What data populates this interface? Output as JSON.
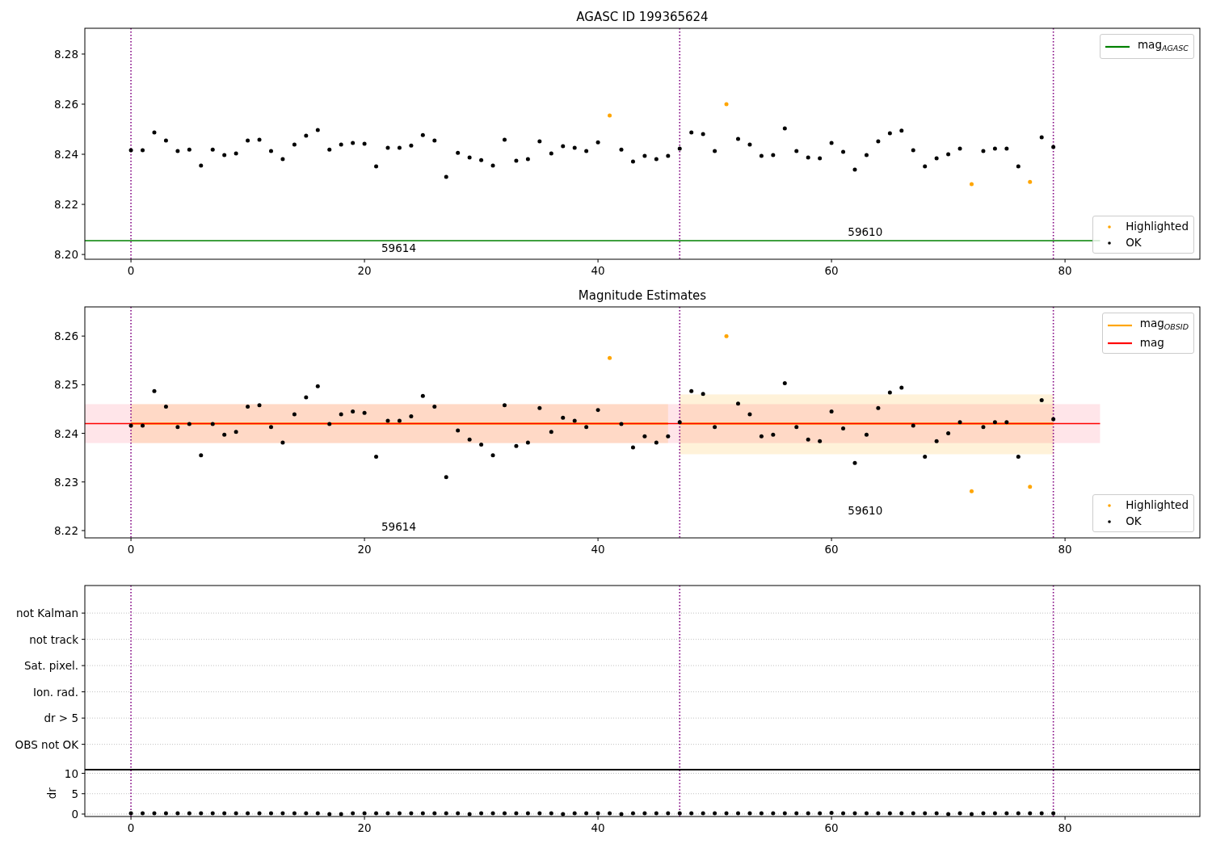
{
  "figure": {
    "panels": [
      {
        "kind": "magnitude",
        "chart_data": {
          "type": "scatter",
          "title": "AGASC ID 199365624",
          "xlim": [
            -3.95,
            91.55
          ],
          "ylim": [
            8.1981,
            8.2903
          ],
          "xticks": [
            0,
            20,
            40,
            60,
            80
          ],
          "yticks": [
            {
              "value": 8.2,
              "label": "8.20"
            },
            {
              "value": 8.22,
              "label": "8.22"
            },
            {
              "value": 8.24,
              "label": "8.24"
            },
            {
              "value": 8.26,
              "label": "8.26"
            },
            {
              "value": 8.28,
              "label": "8.28"
            }
          ],
          "x": [
            0,
            1,
            2,
            3,
            4,
            5,
            6,
            7,
            8,
            9,
            10,
            11,
            12,
            13,
            14,
            15,
            16,
            17,
            18,
            19,
            20,
            21,
            22,
            23,
            24,
            25,
            26,
            27,
            28,
            29,
            30,
            31,
            32,
            33,
            34,
            35,
            36,
            37,
            38,
            39,
            40,
            41,
            42,
            43,
            44,
            45,
            46,
            47,
            48,
            49,
            50,
            51,
            52,
            53,
            54,
            55,
            56,
            57,
            58,
            59,
            60,
            61,
            62,
            63,
            64,
            65,
            66,
            67,
            68,
            69,
            70,
            71,
            72,
            73,
            74,
            75,
            76,
            77,
            78,
            79
          ],
          "series": [
            {
              "name": "Highlighted",
              "color": "#ffa500",
              "values": [
                null,
                null,
                null,
                null,
                null,
                null,
                null,
                null,
                null,
                null,
                null,
                null,
                null,
                null,
                null,
                null,
                null,
                null,
                null,
                null,
                null,
                null,
                null,
                null,
                null,
                null,
                null,
                null,
                null,
                null,
                null,
                null,
                null,
                null,
                null,
                null,
                null,
                null,
                null,
                null,
                null,
                8.2555,
                null,
                null,
                null,
                null,
                null,
                null,
                null,
                null,
                null,
                8.26,
                null,
                null,
                null,
                null,
                null,
                null,
                null,
                null,
                null,
                null,
                null,
                null,
                null,
                null,
                null,
                null,
                null,
                null,
                null,
                null,
                8.2281,
                null,
                null,
                null,
                null,
                8.229,
                null,
                null
              ]
            },
            {
              "name": "OK",
              "color": "#000000",
              "values": [
                8.2416,
                8.2416,
                8.2487,
                8.2455,
                8.2413,
                8.2419,
                8.2355,
                8.2419,
                8.2397,
                8.2403,
                8.2455,
                8.2458,
                8.2413,
                8.2381,
                8.2439,
                8.2474,
                8.2497,
                8.2419,
                8.2439,
                8.2445,
                8.2442,
                8.2352,
                8.2426,
                8.2426,
                8.2435,
                8.2477,
                8.2455,
                8.231,
                8.2406,
                8.2387,
                8.2377,
                8.2355,
                8.2458,
                8.2374,
                8.2381,
                8.2452,
                8.2403,
                8.2432,
                8.2426,
                8.2413,
                8.2448,
                null,
                8.2419,
                8.2371,
                8.2394,
                8.2381,
                8.2394,
                8.2423,
                8.2487,
                8.2481,
                8.2413,
                null,
                8.2461,
                8.2439,
                8.2394,
                8.2397,
                8.2503,
                8.2413,
                8.2387,
                8.2384,
                8.2445,
                8.241,
                8.2339,
                8.2397,
                8.2452,
                8.2484,
                8.2494,
                8.2416,
                8.2352,
                8.2384,
                8.24,
                8.2423,
                null,
                8.2413,
                8.2423,
                8.2423,
                8.2352,
                null,
                8.2468,
                8.2429
              ]
            }
          ],
          "ref_lines": [
            {
              "axis": "y",
              "value": 8.2055,
              "color": "#008000",
              "label": "mag$_{AGASC}$"
            },
            {
              "axis": "x",
              "value": 0,
              "color": "#800080"
            },
            {
              "axis": "x",
              "value": 47,
              "color": "#800080"
            },
            {
              "axis": "x",
              "value": 79,
              "color": "#800080"
            }
          ],
          "annotations": [
            "59614",
            "59610"
          ]
        }
      },
      {
        "kind": "magnitude",
        "chart_data": {
          "type": "scatter",
          "title": "Magnitude Estimates",
          "xlim": [
            -3.95,
            91.55
          ],
          "ylim": [
            8.2185,
            8.266
          ],
          "xticks": [
            0,
            20,
            40,
            60,
            80
          ],
          "yticks": [
            {
              "value": 8.22,
              "label": "8.22"
            },
            {
              "value": 8.23,
              "label": "8.23"
            },
            {
              "value": 8.24,
              "label": "8.24"
            },
            {
              "value": 8.25,
              "label": "8.25"
            },
            {
              "value": 8.26,
              "label": "8.26"
            }
          ],
          "x": [
            0,
            1,
            2,
            3,
            4,
            5,
            6,
            7,
            8,
            9,
            10,
            11,
            12,
            13,
            14,
            15,
            16,
            17,
            18,
            19,
            20,
            21,
            22,
            23,
            24,
            25,
            26,
            27,
            28,
            29,
            30,
            31,
            32,
            33,
            34,
            35,
            36,
            37,
            38,
            39,
            40,
            41,
            42,
            43,
            44,
            45,
            46,
            47,
            48,
            49,
            50,
            51,
            52,
            53,
            54,
            55,
            56,
            57,
            58,
            59,
            60,
            61,
            62,
            63,
            64,
            65,
            66,
            67,
            68,
            69,
            70,
            71,
            72,
            73,
            74,
            75,
            76,
            77,
            78,
            79
          ],
          "series": [
            {
              "name": "Highlighted",
              "color": "#ffa500",
              "values": [
                null,
                null,
                null,
                null,
                null,
                null,
                null,
                null,
                null,
                null,
                null,
                null,
                null,
                null,
                null,
                null,
                null,
                null,
                null,
                null,
                null,
                null,
                null,
                null,
                null,
                null,
                null,
                null,
                null,
                null,
                null,
                null,
                null,
                null,
                null,
                null,
                null,
                null,
                null,
                null,
                null,
                8.2555,
                null,
                null,
                null,
                null,
                null,
                null,
                null,
                null,
                null,
                8.26,
                null,
                null,
                null,
                null,
                null,
                null,
                null,
                null,
                null,
                null,
                null,
                null,
                null,
                null,
                null,
                null,
                null,
                null,
                null,
                null,
                8.2281,
                null,
                null,
                null,
                null,
                8.229,
                null,
                null
              ]
            },
            {
              "name": "OK",
              "color": "#000000",
              "values": [
                8.2416,
                8.2416,
                8.2487,
                8.2455,
                8.2413,
                8.2419,
                8.2355,
                8.2419,
                8.2397,
                8.2403,
                8.2455,
                8.2458,
                8.2413,
                8.2381,
                8.2439,
                8.2474,
                8.2497,
                8.2419,
                8.2439,
                8.2445,
                8.2442,
                8.2352,
                8.2426,
                8.2426,
                8.2435,
                8.2477,
                8.2455,
                8.231,
                8.2406,
                8.2387,
                8.2377,
                8.2355,
                8.2458,
                8.2374,
                8.2381,
                8.2452,
                8.2403,
                8.2432,
                8.2426,
                8.2413,
                8.2448,
                null,
                8.2419,
                8.2371,
                8.2394,
                8.2381,
                8.2394,
                8.2423,
                8.2487,
                8.2481,
                8.2413,
                null,
                8.2461,
                8.2439,
                8.2394,
                8.2397,
                8.2503,
                8.2413,
                8.2387,
                8.2384,
                8.2445,
                8.241,
                8.2339,
                8.2397,
                8.2452,
                8.2484,
                8.2494,
                8.2416,
                8.2352,
                8.2384,
                8.24,
                8.2423,
                null,
                8.2413,
                8.2423,
                8.2423,
                8.2352,
                null,
                8.2468,
                8.2429
              ]
            }
          ],
          "bands": [
            {
              "axis": "y",
              "from": 8.238,
              "to": 8.246,
              "color": "#ffe5e9"
            },
            {
              "axis": "y",
              "from": 8.238,
              "to": 8.246,
              "color": "#fff2d9"
            },
            {
              "axis": "y",
              "from": 8.2357,
              "to": 8.248,
              "color": "#fff2d9"
            }
          ],
          "ref_lines": [
            {
              "axis": "y",
              "value": 8.242,
              "color": "#ff0000",
              "label": "mag"
            },
            {
              "axis": "y",
              "value": 8.242,
              "color": "#ffa500",
              "label": "mag$_{OBSID}$"
            },
            {
              "axis": "x",
              "value": 0,
              "color": "#800080"
            },
            {
              "axis": "x",
              "value": 47,
              "color": "#800080"
            },
            {
              "axis": "x",
              "value": 79,
              "color": "#800080"
            }
          ],
          "annotations": [
            "59614",
            "59610"
          ]
        }
      },
      {
        "kind": "flags",
        "chart_data": {
          "type": "scatter",
          "xlim": [
            -3.95,
            91.55
          ],
          "grid": true,
          "orientation": "horizontal",
          "categories": [
            "not Kalman",
            "not track",
            "Sat. pixel.",
            "Ion. rad.",
            "dr > 5",
            "OBS not OK"
          ],
          "ref_lines": [
            {
              "axis": "x",
              "value": 0,
              "color": "#800080"
            },
            {
              "axis": "x",
              "value": 47,
              "color": "#800080"
            },
            {
              "axis": "x",
              "value": 79,
              "color": "#800080"
            }
          ]
        }
      },
      {
        "kind": "dr",
        "chart_data": {
          "type": "scatter",
          "ylabel": "dr",
          "xlim": [
            -3.95,
            91.55
          ],
          "ylim": [
            -0.6,
            10.8
          ],
          "xticks": [
            0,
            20,
            40,
            60,
            80
          ],
          "yticks": [
            0,
            5,
            10
          ],
          "x": [
            0,
            1,
            2,
            3,
            4,
            5,
            6,
            7,
            8,
            9,
            10,
            11,
            12,
            13,
            14,
            15,
            16,
            17,
            18,
            19,
            20,
            21,
            22,
            23,
            24,
            25,
            26,
            27,
            28,
            29,
            30,
            31,
            32,
            33,
            34,
            35,
            36,
            37,
            38,
            39,
            40,
            41,
            42,
            43,
            44,
            45,
            46,
            47,
            48,
            49,
            50,
            51,
            52,
            53,
            54,
            55,
            56,
            57,
            58,
            59,
            60,
            61,
            62,
            63,
            64,
            65,
            66,
            67,
            68,
            69,
            70,
            71,
            72,
            73,
            74,
            75,
            76,
            77,
            78,
            79
          ],
          "series": [
            {
              "color": "#000000",
              "values": [
                0.2,
                0.2,
                0.2,
                0.2,
                0.2,
                0.2,
                0.2,
                0.2,
                0.2,
                0.2,
                0.2,
                0.2,
                0.2,
                0.2,
                0.2,
                0.2,
                0.2,
                0,
                0,
                0.2,
                0.2,
                0.2,
                0.2,
                0.2,
                0.2,
                0.2,
                0.2,
                0.2,
                0.2,
                0,
                0.2,
                0.2,
                0.2,
                0.2,
                0.2,
                0.2,
                0.2,
                0,
                0.2,
                0.2,
                0.2,
                0.2,
                0,
                0.2,
                0.2,
                0.2,
                0.2,
                0.2,
                0.2,
                0.2,
                0.2,
                0.2,
                0.2,
                0.2,
                0.2,
                0.2,
                0.2,
                0.2,
                0.2,
                0.2,
                0.3,
                0.2,
                0.2,
                0.2,
                0.2,
                0.2,
                0.2,
                0.2,
                0.2,
                0.2,
                0,
                0.2,
                0,
                0.2,
                0.2,
                0.2,
                0.2,
                0.2,
                0.2,
                0.2
              ]
            }
          ],
          "grid": true,
          "ref_lines": [
            {
              "axis": "x",
              "value": 0,
              "color": "#800080"
            },
            {
              "axis": "x",
              "value": 47,
              "color": "#800080"
            },
            {
              "axis": "x",
              "value": 79,
              "color": "#800080"
            }
          ]
        }
      }
    ]
  }
}
